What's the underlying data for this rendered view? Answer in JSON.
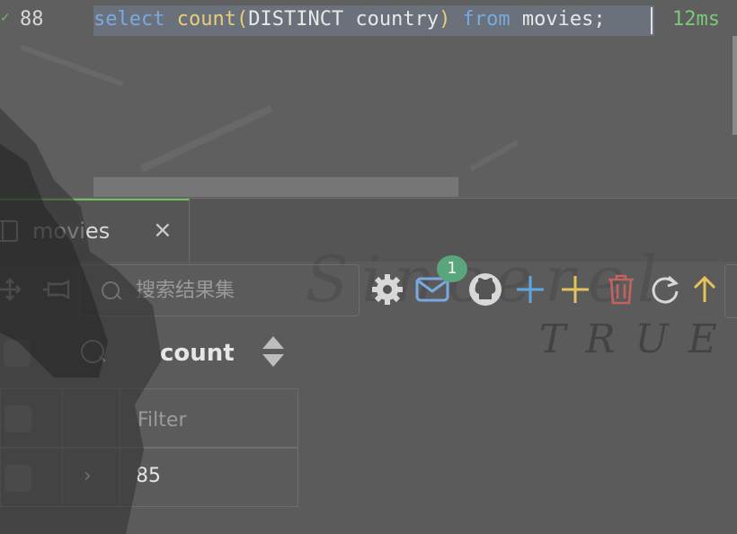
{
  "editor": {
    "line_number": "88",
    "code": {
      "kw_select": "select",
      "fn_count": "count",
      "paren_open": "(",
      "ident_distinct": "DISTINCT",
      "ident_country": "country",
      "paren_close": ")",
      "kw_from": "from",
      "ident_movies": "movies;"
    },
    "timing": "12ms"
  },
  "tab": {
    "label": "movies",
    "close": "×"
  },
  "toolbar": {
    "search_placeholder": "搜索结果集",
    "notification_count": "1",
    "icons": [
      "move-icon",
      "pin-icon",
      "gear-icon",
      "mail-icon",
      "github-icon",
      "add-row-icon",
      "add-icon",
      "trash-icon",
      "refresh-icon",
      "up-icon"
    ],
    "colors": {
      "mail": "#7aa9df",
      "add_blue": "#5aa9e6",
      "add_yellow": "#e6c35a",
      "trash": "#c2635e",
      "up": "#e6c35a",
      "badge": "#5ba57d"
    }
  },
  "watermark": {
    "line1": "Sincerel",
    "line2": "TRUE"
  },
  "grid": {
    "column": "count",
    "filter_placeholder": "Filter",
    "rows": [
      {
        "count": "85"
      }
    ]
  }
}
